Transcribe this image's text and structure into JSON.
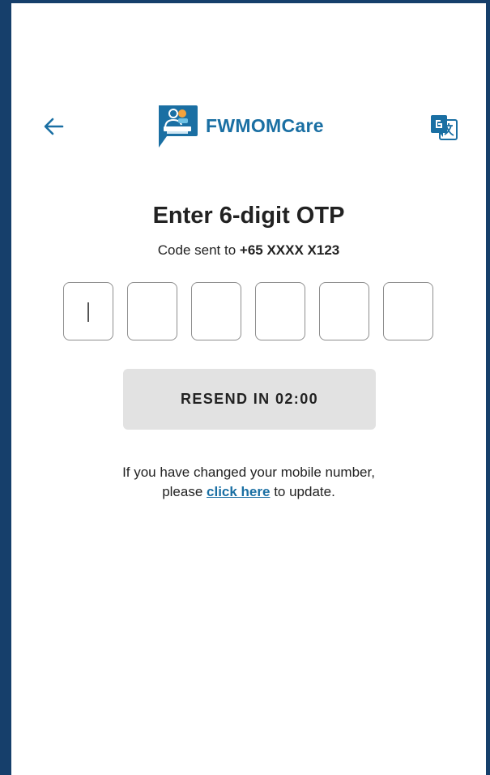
{
  "app": {
    "name": "FWMOMCare"
  },
  "header": {
    "back_icon": "arrow-left-icon",
    "translate_icon": "google-translate-icon",
    "accent_color": "#1a6fa3"
  },
  "otp": {
    "title": "Enter 6-digit OTP",
    "subtitle_prefix": "Code sent to ",
    "phone_masked": "+65 XXXX X123",
    "digits": [
      "",
      "",
      "",
      "",
      "",
      ""
    ],
    "digit_count": 6
  },
  "resend": {
    "label": "RESEND IN 02:00"
  },
  "info": {
    "line1": "If you have changed your mobile number,",
    "line2_prefix": "please ",
    "link_text": "click here",
    "line2_suffix": " to update."
  }
}
